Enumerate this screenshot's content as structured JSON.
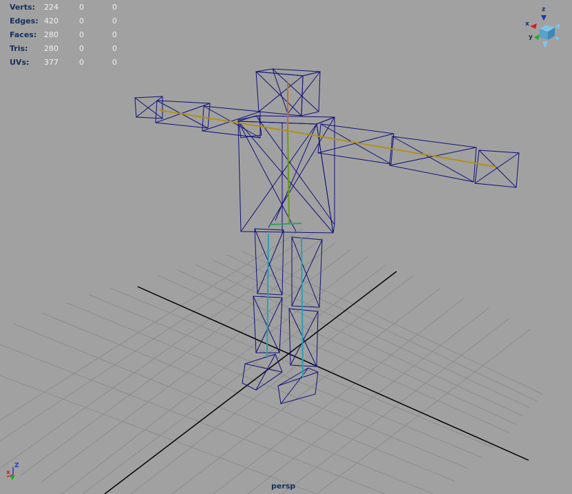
{
  "hud": {
    "rows": [
      {
        "label": "Verts:",
        "v1": "224",
        "v2": "0",
        "v3": "0"
      },
      {
        "label": "Edges:",
        "v1": "420",
        "v2": "0",
        "v3": "0"
      },
      {
        "label": "Faces:",
        "v1": "280",
        "v2": "0",
        "v3": "0"
      },
      {
        "label": "Tris:",
        "v1": "280",
        "v2": "0",
        "v3": "0"
      },
      {
        "label": "UVs:",
        "v1": "377",
        "v2": "0",
        "v3": "0"
      }
    ]
  },
  "camera": {
    "name": "persp"
  },
  "view_cube": {
    "x_label": "x",
    "y_label": "y",
    "z_label": "z"
  },
  "origin_axis": {
    "x_label": "x",
    "z_label": "Z"
  },
  "colors": {
    "background": "#a1a1a1",
    "grid": "#8a8a8a",
    "grid_axis": "#000000",
    "wireframe": "#0f0f7a",
    "hud_label": "#14305a",
    "hud_value": "#f0f0f0"
  }
}
